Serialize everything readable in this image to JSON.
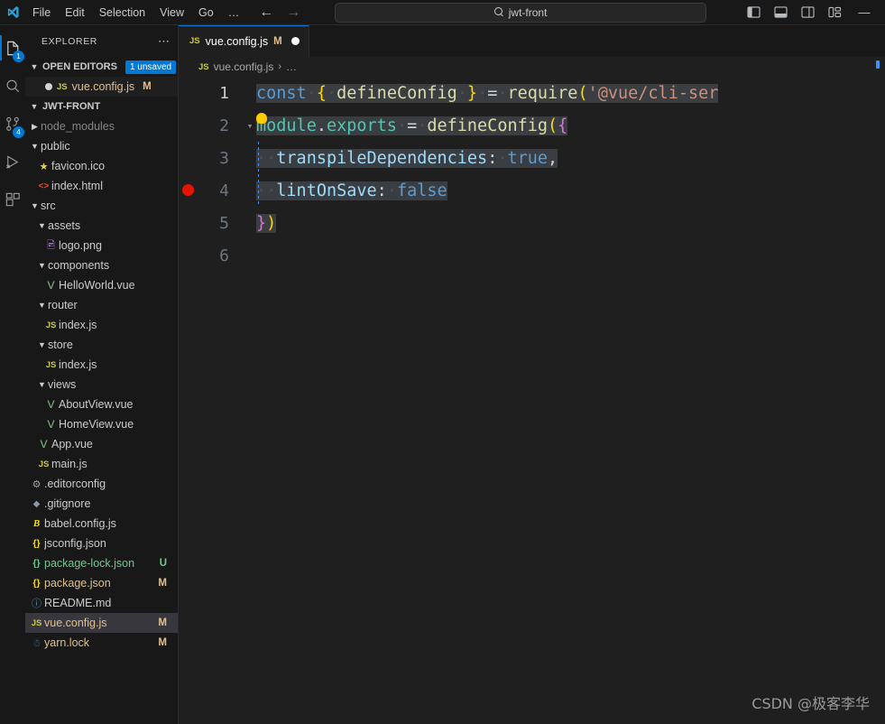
{
  "titlebar": {
    "logo_icon": "vscode-logo-icon",
    "menus": [
      "File",
      "Edit",
      "Selection",
      "View",
      "Go",
      "…"
    ],
    "back_icon": "arrow-left-icon",
    "forward_icon": "arrow-right-icon",
    "search": {
      "value": "jwt-front",
      "icon": "search-icon"
    },
    "layout_buttons": [
      {
        "name": "toggle-primary-sidebar",
        "icon": "panel-left-icon"
      },
      {
        "name": "toggle-panel",
        "icon": "panel-bottom-icon"
      },
      {
        "name": "toggle-secondary-sidebar",
        "icon": "panel-right-icon"
      },
      {
        "name": "customize-layout",
        "icon": "layout-grid-icon"
      }
    ],
    "minimize_label": "—"
  },
  "activitybar": {
    "items": [
      {
        "name": "explorer",
        "icon": "files-icon",
        "badge": "1",
        "active": true
      },
      {
        "name": "search",
        "icon": "search-icon",
        "badge": ""
      },
      {
        "name": "source-control",
        "icon": "source-control-icon",
        "badge": "4"
      },
      {
        "name": "run-and-debug",
        "icon": "run-debug-icon",
        "badge": ""
      },
      {
        "name": "extensions",
        "icon": "extensions-icon",
        "badge": ""
      }
    ]
  },
  "sidebar": {
    "title": "EXPLORER",
    "more_actions": "⋯",
    "open_editors": {
      "label": "OPEN EDITORS",
      "badge": "1 unsaved",
      "items": [
        {
          "name": "vue.config.js",
          "icon": "js-icon",
          "git": "M",
          "dirty": true
        }
      ]
    },
    "project": {
      "label": "JWT-FRONT",
      "tree": [
        {
          "name": "node_modules",
          "type": "folder",
          "depth": 1,
          "expanded": false,
          "icon": "",
          "git": "",
          "gitclass": "",
          "dim": true
        },
        {
          "name": "public",
          "type": "folder",
          "depth": 1,
          "expanded": true,
          "icon": "",
          "git": "",
          "gitclass": "",
          "dim": false
        },
        {
          "name": "favicon.ico",
          "type": "file",
          "depth": 2,
          "icon": "star-icon",
          "git": "",
          "gitclass": "",
          "dim": false
        },
        {
          "name": "index.html",
          "type": "file",
          "depth": 2,
          "icon": "html-icon",
          "git": "",
          "gitclass": "",
          "dim": false
        },
        {
          "name": "src",
          "type": "folder",
          "depth": 1,
          "expanded": true,
          "icon": "",
          "git": "",
          "gitclass": "",
          "dim": false
        },
        {
          "name": "assets",
          "type": "folder",
          "depth": 2,
          "expanded": true,
          "icon": "",
          "git": "",
          "gitclass": "",
          "dim": false
        },
        {
          "name": "logo.png",
          "type": "file",
          "depth": 3,
          "icon": "image-icon",
          "git": "",
          "gitclass": "",
          "dim": false
        },
        {
          "name": "components",
          "type": "folder",
          "depth": 2,
          "expanded": true,
          "icon": "",
          "git": "",
          "gitclass": "",
          "dim": false
        },
        {
          "name": "HelloWorld.vue",
          "type": "file",
          "depth": 3,
          "icon": "vue-icon",
          "git": "",
          "gitclass": "",
          "dim": false
        },
        {
          "name": "router",
          "type": "folder",
          "depth": 2,
          "expanded": true,
          "icon": "",
          "git": "",
          "gitclass": "",
          "dim": false
        },
        {
          "name": "index.js",
          "type": "file",
          "depth": 3,
          "icon": "js-icon",
          "git": "",
          "gitclass": "",
          "dim": false
        },
        {
          "name": "store",
          "type": "folder",
          "depth": 2,
          "expanded": true,
          "icon": "",
          "git": "",
          "gitclass": "",
          "dim": false
        },
        {
          "name": "index.js",
          "type": "file",
          "depth": 3,
          "icon": "js-icon",
          "git": "",
          "gitclass": "",
          "dim": false
        },
        {
          "name": "views",
          "type": "folder",
          "depth": 2,
          "expanded": true,
          "icon": "",
          "git": "",
          "gitclass": "",
          "dim": false
        },
        {
          "name": "AboutView.vue",
          "type": "file",
          "depth": 3,
          "icon": "vue-icon",
          "git": "",
          "gitclass": "",
          "dim": false
        },
        {
          "name": "HomeView.vue",
          "type": "file",
          "depth": 3,
          "icon": "vue-icon",
          "git": "",
          "gitclass": "",
          "dim": false
        },
        {
          "name": "App.vue",
          "type": "file",
          "depth": 2,
          "icon": "vue-icon",
          "git": "",
          "gitclass": "",
          "dim": false
        },
        {
          "name": "main.js",
          "type": "file",
          "depth": 2,
          "icon": "js-icon",
          "git": "",
          "gitclass": "",
          "dim": false
        },
        {
          "name": ".editorconfig",
          "type": "file",
          "depth": 1,
          "icon": "gear-icon",
          "git": "",
          "gitclass": "",
          "dim": false
        },
        {
          "name": ".gitignore",
          "type": "file",
          "depth": 1,
          "icon": "git-icon",
          "git": "",
          "gitclass": "",
          "dim": false
        },
        {
          "name": "babel.config.js",
          "type": "file",
          "depth": 1,
          "icon": "babel-icon",
          "git": "",
          "gitclass": "",
          "dim": false
        },
        {
          "name": "jsconfig.json",
          "type": "file",
          "depth": 1,
          "icon": "json-icon",
          "git": "",
          "gitclass": "",
          "dim": false
        },
        {
          "name": "package-lock.json",
          "type": "file",
          "depth": 1,
          "icon": "json-icon-green",
          "git": "U",
          "gitclass": "untracked",
          "dim": false
        },
        {
          "name": "package.json",
          "type": "file",
          "depth": 1,
          "icon": "json-icon",
          "git": "M",
          "gitclass": "mod",
          "dim": false
        },
        {
          "name": "README.md",
          "type": "file",
          "depth": 1,
          "icon": "info-icon",
          "git": "",
          "gitclass": "",
          "dim": false
        },
        {
          "name": "vue.config.js",
          "type": "file",
          "depth": 1,
          "icon": "js-icon",
          "git": "M",
          "gitclass": "mod",
          "dim": false,
          "selected": true
        },
        {
          "name": "yarn.lock",
          "type": "file",
          "depth": 1,
          "icon": "yarn-icon",
          "git": "M",
          "gitclass": "mod",
          "dim": false
        }
      ]
    }
  },
  "editor": {
    "tabs": [
      {
        "name": "vue.config.js",
        "icon": "js-icon",
        "git": "M",
        "dirty": true,
        "active": true
      }
    ],
    "breadcrumb": {
      "icon": "js-icon",
      "file": "vue.config.js",
      "separator": "›",
      "rest": "…"
    },
    "code": {
      "lines": [
        {
          "num": "1",
          "breakpoint": false,
          "fold": "",
          "tokens": [
            {
              "text": "const",
              "cls": "t-key",
              "sel": true
            },
            {
              "text": "·",
              "cls": "t-dot",
              "sel": true
            },
            {
              "text": "{",
              "cls": "t-brc",
              "sel": true
            },
            {
              "text": "·",
              "cls": "t-dot",
              "sel": true
            },
            {
              "text": "defineConfig",
              "cls": "t-fn",
              "sel": true
            },
            {
              "text": "·",
              "cls": "t-dot",
              "sel": true
            },
            {
              "text": "}",
              "cls": "t-brc",
              "sel": true
            },
            {
              "text": "·",
              "cls": "t-dot",
              "sel": true
            },
            {
              "text": "=",
              "cls": "t-op",
              "sel": true
            },
            {
              "text": "·",
              "cls": "t-dot",
              "sel": true
            },
            {
              "text": "require",
              "cls": "t-fn",
              "sel": true
            },
            {
              "text": "(",
              "cls": "t-brc",
              "sel": true
            },
            {
              "text": "'@vue/cli-ser",
              "cls": "t-str",
              "sel": true
            }
          ]
        },
        {
          "num": "2",
          "breakpoint": false,
          "fold": "⌄",
          "bulb": true,
          "tokens": [
            {
              "text": "module",
              "cls": "t-prop",
              "sel": true
            },
            {
              "text": ".",
              "cls": "t-op",
              "sel": true
            },
            {
              "text": "exports",
              "cls": "t-prop",
              "sel": true
            },
            {
              "text": "·",
              "cls": "t-dot",
              "sel": true
            },
            {
              "text": "=",
              "cls": "t-op",
              "sel": true
            },
            {
              "text": "·",
              "cls": "t-dot",
              "sel": true
            },
            {
              "text": "defineConfig",
              "cls": "t-fn",
              "sel": true
            },
            {
              "text": "(",
              "cls": "t-brc",
              "sel": true
            },
            {
              "text": "{",
              "cls": "t-brc2",
              "sel": true
            }
          ]
        },
        {
          "num": "3",
          "breakpoint": false,
          "fold": "",
          "indent": true,
          "tokens": [
            {
              "text": "··",
              "cls": "t-dot",
              "sel": true
            },
            {
              "text": "transpileDependencies",
              "cls": "t-var",
              "sel": true
            },
            {
              "text": ":",
              "cls": "t-op",
              "sel": true
            },
            {
              "text": "·",
              "cls": "t-dot",
              "sel": true
            },
            {
              "text": "true",
              "cls": "t-key",
              "sel": true
            },
            {
              "text": ",",
              "cls": "t-op",
              "sel": true
            }
          ]
        },
        {
          "num": "4",
          "breakpoint": true,
          "fold": "",
          "indent": true,
          "tokens": [
            {
              "text": "··",
              "cls": "t-dot",
              "sel": true
            },
            {
              "text": "lintOnSave",
              "cls": "t-var",
              "sel": true
            },
            {
              "text": ":",
              "cls": "t-op",
              "sel": true
            },
            {
              "text": "·",
              "cls": "t-dot",
              "sel": true
            },
            {
              "text": "false",
              "cls": "t-key",
              "sel": true
            }
          ]
        },
        {
          "num": "5",
          "breakpoint": false,
          "fold": "",
          "tokens": [
            {
              "text": "}",
              "cls": "t-brc2",
              "sel": true
            },
            {
              "text": ")",
              "cls": "t-brc",
              "sel": true
            }
          ]
        },
        {
          "num": "6",
          "breakpoint": false,
          "fold": "",
          "tokens": []
        }
      ]
    }
  },
  "watermark": "CSDN @极客李华"
}
